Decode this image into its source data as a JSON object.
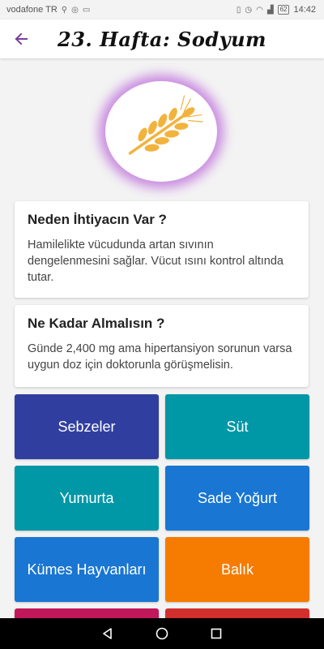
{
  "status_bar": {
    "carrier": "vodafone TR",
    "battery": "62",
    "time": "14:42"
  },
  "app_bar": {
    "title": "23. Hafta: Sodyum",
    "back_icon": "arrow-back-icon"
  },
  "hero": {
    "icon": "wheat-icon"
  },
  "cards": [
    {
      "title": "Neden İhtiyacın Var ?",
      "text": "Hamilelikte vücudunda artan sıvının dengelenmesini sağlar. Vücut ısını kontrol altında tutar."
    },
    {
      "title": "Ne Kadar Almalısın ?",
      "text": "Günde 2,400 mg ama hipertansiyon sorunun varsa uygun doz için doktorunla görüşmelisin."
    }
  ],
  "tiles": [
    {
      "label": "Sebzeler",
      "color": "#303f9f"
    },
    {
      "label": "Süt",
      "color": "#0097a7"
    },
    {
      "label": "Yumurta",
      "color": "#0097a7"
    },
    {
      "label": "Sade Yoğurt",
      "color": "#1976d2"
    },
    {
      "label": "Kümes Hayvanları",
      "color": "#1976d2"
    },
    {
      "label": "Balık",
      "color": "#f57c00"
    },
    {
      "label": "",
      "color": "#c2185b"
    },
    {
      "label": "",
      "color": "#d32f2f"
    }
  ],
  "colors": {
    "accent": "#7b3fa0",
    "wheat": "#f2b33d",
    "hero_glow": "#c98ae0"
  }
}
